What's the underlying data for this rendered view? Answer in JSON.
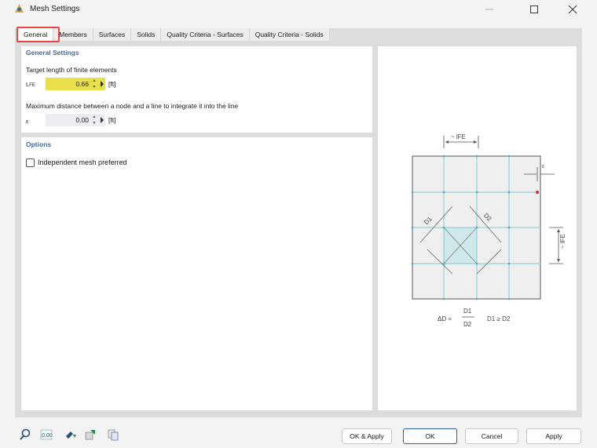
{
  "window": {
    "title": "Mesh Settings"
  },
  "tabs": [
    {
      "label": "General",
      "active": true
    },
    {
      "label": "Members"
    },
    {
      "label": "Surfaces"
    },
    {
      "label": "Solids"
    },
    {
      "label": "Quality Criteria - Surfaces"
    },
    {
      "label": "Quality Criteria - Solids"
    }
  ],
  "general": {
    "heading": "General Settings",
    "target_length_label": "Target length of finite elements",
    "lfe_symbol_main": "L",
    "lfe_symbol_sub": "FE",
    "lfe_value": "0.66",
    "lfe_unit": "[ft]",
    "max_distance_label": "Maximum distance between a node and a line to integrate it into the line",
    "eps_symbol": "ε",
    "eps_value": "0.00",
    "eps_unit": "[ft]"
  },
  "options": {
    "heading": "Options",
    "independent_mesh_label": "Independent mesh preferred",
    "independent_mesh_checked": false
  },
  "diagram": {
    "lfe_top": "~ lFE",
    "lfe_side": "~ lFE",
    "eps": "ε",
    "d1": "D1",
    "d2": "D2",
    "delta": "ΔD =",
    "frac_num": "D1",
    "frac_den": "D2",
    "condition": "D1 ≥ D2"
  },
  "buttons": {
    "ok_apply": "OK & Apply",
    "ok": "OK",
    "cancel": "Cancel",
    "apply": "Apply"
  },
  "colors": {
    "accent": "#2b5fa6",
    "highlight": "#e4473f",
    "field_active": "#e8e04a",
    "mesh_line": "#7fc8d6"
  }
}
